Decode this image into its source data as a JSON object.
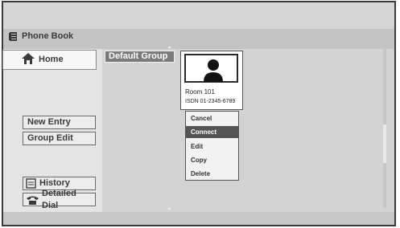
{
  "header": {
    "title": "Phone Book",
    "title_icon": "phone-book-icon"
  },
  "sidebar": {
    "home_label": "Home",
    "home_icon": "house-icon",
    "new_entry_label": "New Entry",
    "group_edit_label": "Group Edit",
    "history_label": "History",
    "history_icon": "history-icon",
    "detailed_dial_label": "Detailed Dial",
    "detailed_dial_icon": "phone-icon"
  },
  "main": {
    "group_tab_label": "Default Group",
    "entry": {
      "name": "Room 101",
      "number": "ISDN 01-2345-6789",
      "avatar_icon": "person-icon"
    },
    "context_menu": {
      "items": [
        "Cancel",
        "Connect",
        "Edit",
        "Copy",
        "Delete"
      ],
      "selected": "Connect"
    }
  },
  "colors": {
    "selected_bg": "#555555",
    "tab_bg": "#7b7b7b",
    "frame": "#3a3a3a"
  }
}
